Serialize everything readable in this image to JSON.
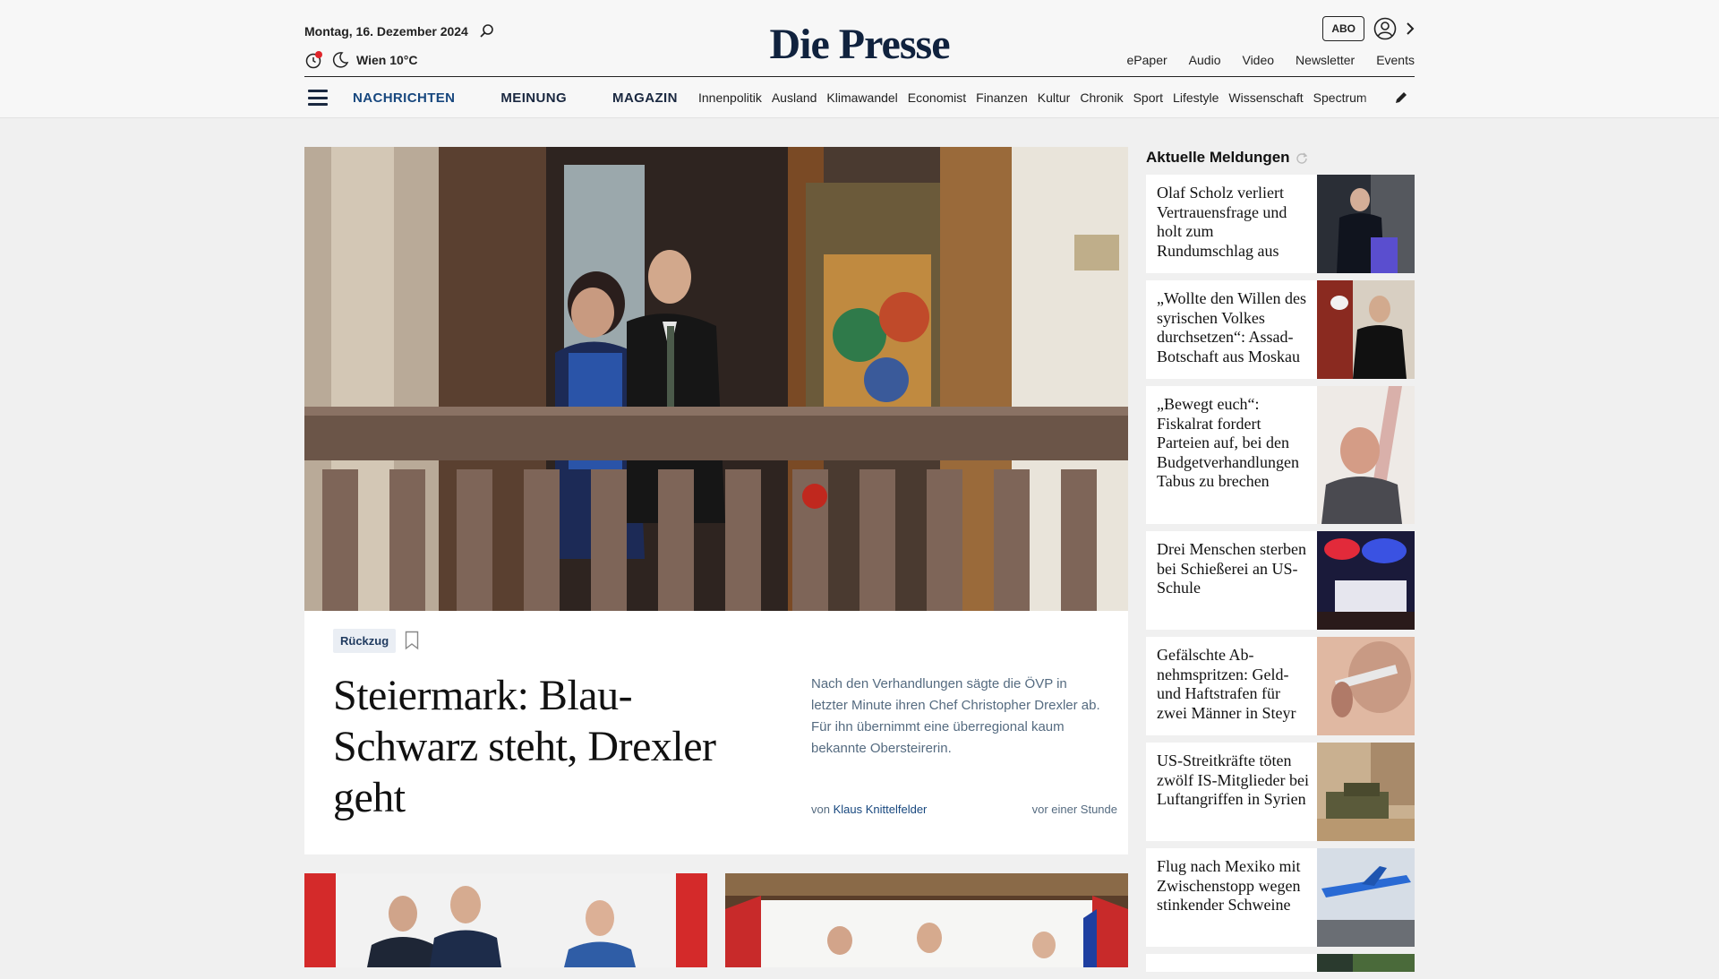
{
  "header": {
    "date": "Montag, 16. Dezember 2024",
    "weather": "Wien 10°C",
    "logo": "Die Presse",
    "abo": "ABO",
    "links": [
      "ePaper",
      "Audio",
      "Video",
      "Newsletter",
      "Events"
    ]
  },
  "nav": {
    "main": [
      "NACHRICHTEN",
      "MEINUNG",
      "MAGAZIN"
    ],
    "sub": [
      "Innenpolitik",
      "Ausland",
      "Klimawandel",
      "Economist",
      "Finanzen",
      "Kultur",
      "Chronik",
      "Sport",
      "Lifestyle",
      "Wissenschaft",
      "Spectrum"
    ]
  },
  "hero": {
    "tag": "Rückzug",
    "headline": "Steiermark: Blau-Schwarz steht, Drexler geht",
    "lead": "Nach den Verhandlungen sägte die ÖVP in letzter Minute ihren Chef Christopher Drexler ab. Für ihn übernimmt eine überregional kaum bekannte Obersteirerin.",
    "by_prefix": "von",
    "author": "Klaus Knittelfelder",
    "time": "vor einer Stunde"
  },
  "sidebar": {
    "title": "Aktuelle Meldungen",
    "items": [
      {
        "text": "Olaf Scholz verliert Vertrauensfrage und holt zum Rundumschlag aus"
      },
      {
        "text": "„Wollte den Willen des syrischen Volkes durchsetzen“: Assad-Botschaft aus Moskau"
      },
      {
        "text": "„Bewegt euch“: Fiskalrat fordert Parteien auf, bei den Budget­verhandlungen Tabus zu brechen"
      },
      {
        "text": "Drei Menschen sterben bei Schießerei an US-Schule"
      },
      {
        "text": "Gefälschte Ab­nehmspritzen: Geld- und Haftstrafen für zwei Männer in Steyr"
      },
      {
        "text": "US-Streitkräfte töten zwölf IS-Mitglieder bei Luftangriffen in Syrien"
      },
      {
        "text": "Flug nach Mexiko mit Zwischenstopp wegen stinkender Schweine"
      }
    ]
  }
}
